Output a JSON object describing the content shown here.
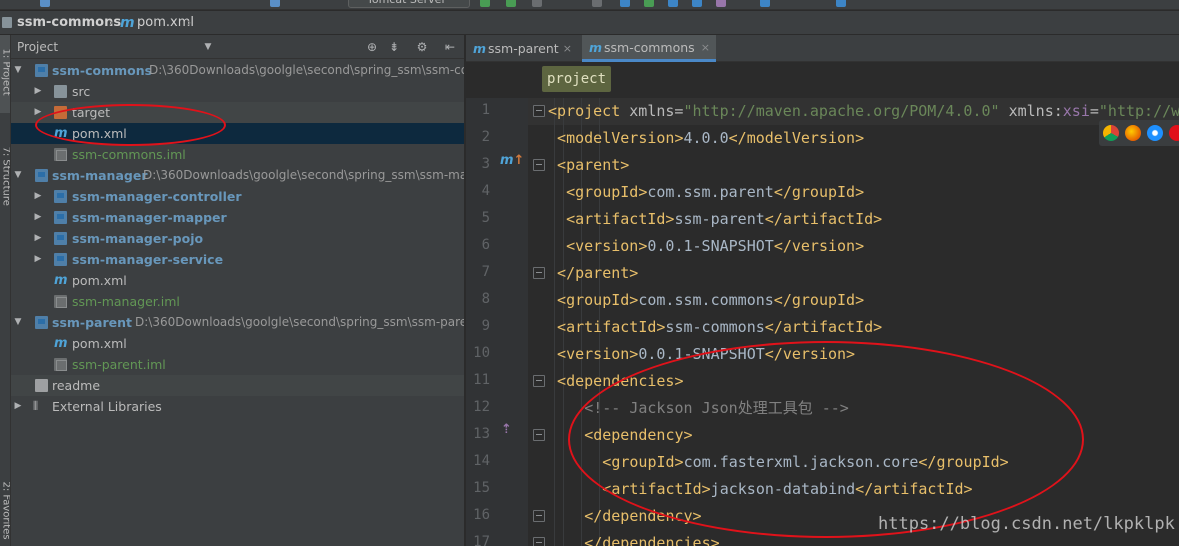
{
  "toolbar": {
    "run_config_label": "Tomcat Server"
  },
  "breadcrumb": {
    "project": "ssm-commons",
    "file": "pom.xml"
  },
  "tool_stripe": {
    "project_tab": "1: Project",
    "structure_tab": "7: Structure",
    "favorites_tab": "2: Favorites"
  },
  "project_panel": {
    "title": "Project",
    "tree": [
      {
        "label": "ssm-commons",
        "path": "D:\\360Downloads\\goolgle\\second\\spring_ssm\\ssm-co"
      },
      {
        "label": "src"
      },
      {
        "label": "target"
      },
      {
        "label": "pom.xml"
      },
      {
        "label": "ssm-commons.iml"
      },
      {
        "label": "ssm-manager",
        "path": "D:\\360Downloads\\goolgle\\second\\spring_ssm\\ssm-ma"
      },
      {
        "label": "ssm-manager-controller"
      },
      {
        "label": "ssm-manager-mapper"
      },
      {
        "label": "ssm-manager-pojo"
      },
      {
        "label": "ssm-manager-service"
      },
      {
        "label": "pom.xml"
      },
      {
        "label": "ssm-manager.iml"
      },
      {
        "label": "ssm-parent",
        "path": "D:\\360Downloads\\goolgle\\second\\spring_ssm\\ssm-paren"
      },
      {
        "label": "pom.xml"
      },
      {
        "label": "ssm-parent.iml"
      },
      {
        "label": "readme"
      },
      {
        "label": "External Libraries"
      }
    ]
  },
  "editor_tabs": [
    {
      "label": "ssm-parent",
      "close": "×"
    },
    {
      "label": "ssm-commons",
      "close": "×"
    }
  ],
  "editor": {
    "tag_breadcrumb": "project",
    "line_numbers": [
      "1",
      "2",
      "3",
      "4",
      "5",
      "6",
      "7",
      "8",
      "9",
      "10",
      "11",
      "12",
      "13",
      "14",
      "15",
      "16",
      "17"
    ],
    "lines": [
      [
        {
          "c": "tag",
          "t": "<project "
        },
        {
          "c": "attr",
          "t": "xmlns="
        },
        {
          "c": "val",
          "t": "\"http://maven.apache.org/POM/4.0.0\" "
        },
        {
          "c": "attr",
          "t": "xmlns:"
        },
        {
          "c": "ns",
          "t": "xsi"
        },
        {
          "c": "attr",
          "t": "="
        },
        {
          "c": "val",
          "t": "\"http://w"
        }
      ],
      [
        {
          "c": "tag",
          "t": "<modelVersion>"
        },
        {
          "c": "txt",
          "t": "4.0.0"
        },
        {
          "c": "tag",
          "t": "</modelVersion>"
        }
      ],
      [
        {
          "c": "tag",
          "t": "<parent>"
        }
      ],
      [
        {
          "c": "tag",
          "t": "<groupId>"
        },
        {
          "c": "txt",
          "t": "com.ssm.parent"
        },
        {
          "c": "tag",
          "t": "</groupId>"
        }
      ],
      [
        {
          "c": "tag",
          "t": "<artifactId>"
        },
        {
          "c": "txt",
          "t": "ssm-parent"
        },
        {
          "c": "tag",
          "t": "</artifactId>"
        }
      ],
      [
        {
          "c": "tag",
          "t": "<version>"
        },
        {
          "c": "txt",
          "t": "0.0.1-SNAPSHOT"
        },
        {
          "c": "tag",
          "t": "</version>"
        }
      ],
      [
        {
          "c": "tag",
          "t": "</parent>"
        }
      ],
      [
        {
          "c": "tag",
          "t": "<groupId>"
        },
        {
          "c": "txt",
          "t": "com.ssm.commons"
        },
        {
          "c": "tag",
          "t": "</groupId>"
        }
      ],
      [
        {
          "c": "tag",
          "t": "<artifactId>"
        },
        {
          "c": "txt",
          "t": "ssm-commons"
        },
        {
          "c": "tag",
          "t": "</artifactId>"
        }
      ],
      [
        {
          "c": "tag",
          "t": "<version>"
        },
        {
          "c": "txt",
          "t": "0.0.1-SNAPSHOT"
        },
        {
          "c": "tag",
          "t": "</version>"
        }
      ],
      [
        {
          "c": "tag",
          "t": "<dependencies>"
        }
      ],
      [
        {
          "c": "cmt",
          "t": "<!-- Jackson Json处理工具包 -->"
        }
      ],
      [
        {
          "c": "tag",
          "t": "<dependency>"
        }
      ],
      [
        {
          "c": "tag",
          "t": "<groupId>"
        },
        {
          "c": "txt",
          "t": "com.fasterxml.jackson.core"
        },
        {
          "c": "tag",
          "t": "</groupId>"
        }
      ],
      [
        {
          "c": "tag",
          "t": "<artifactId>"
        },
        {
          "c": "txt",
          "t": "jackson-databind"
        },
        {
          "c": "tag",
          "t": "</artifactId>"
        }
      ],
      [
        {
          "c": "tag",
          "t": "</dependency>"
        }
      ],
      [
        {
          "c": "tag",
          "t": "</dependencies>"
        }
      ]
    ]
  },
  "watermark": "https://blog.csdn.net/lkpklpk"
}
